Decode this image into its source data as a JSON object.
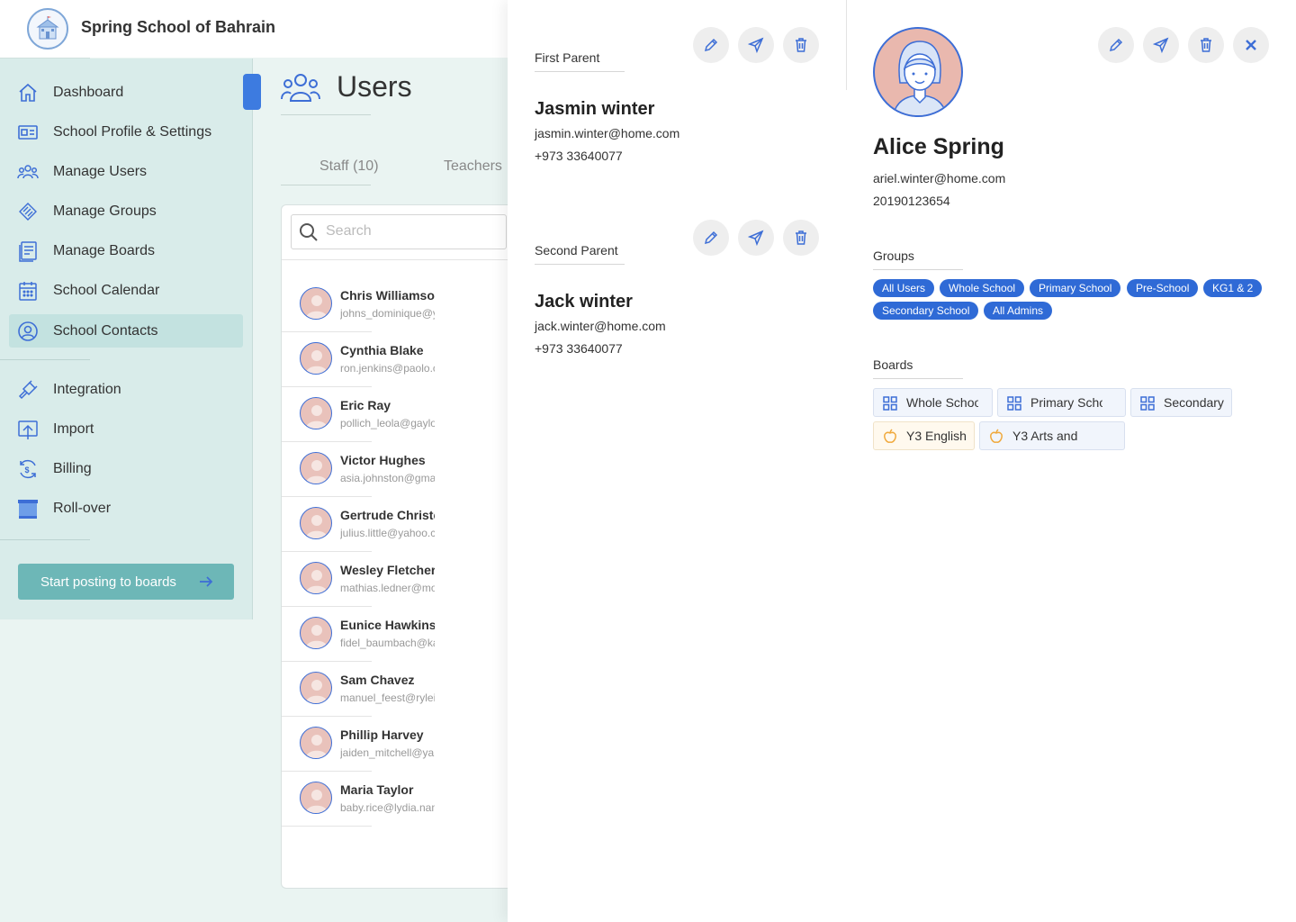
{
  "app": {
    "school_name": "Spring School of Bahrain"
  },
  "sidebar": {
    "items": [
      {
        "label": "Dashboard",
        "icon": "home-icon"
      },
      {
        "label": "School Profile & Settings",
        "icon": "id-card-icon"
      },
      {
        "label": "Manage Users",
        "icon": "users-icon"
      },
      {
        "label": "Manage Groups",
        "icon": "groups-icon"
      },
      {
        "label": "Manage Boards",
        "icon": "board-icon"
      },
      {
        "label": "School Calendar",
        "icon": "calendar-icon"
      },
      {
        "label": "School Contacts",
        "icon": "contact-icon",
        "active": true
      },
      {
        "label": "Integration",
        "icon": "plug-icon"
      },
      {
        "label": "Import",
        "icon": "import-icon"
      },
      {
        "label": "Billing",
        "icon": "billing-icon"
      },
      {
        "label": "Roll-over",
        "icon": "rollover-icon"
      }
    ],
    "cta_label": "Start posting to boards"
  },
  "main": {
    "title": "Users",
    "tabs": [
      {
        "label": "Staff (10)"
      },
      {
        "label": "Teachers"
      }
    ],
    "search": {
      "placeholder": "Search",
      "value": ""
    },
    "users": [
      {
        "name": "Chris Williamson",
        "email": "johns_dominique@yahoo.com"
      },
      {
        "name": "Cynthia Blake",
        "email": "ron.jenkins@paolo.com"
      },
      {
        "name": "Eric Ray",
        "email": "pollich_leola@gaylord.com"
      },
      {
        "name": "Victor Hughes",
        "email": "asia.johnston@gmail.com"
      },
      {
        "name": "Gertrude Christensen",
        "email": "julius.little@yahoo.com"
      },
      {
        "name": "Wesley Fletcher",
        "email": "mathias.ledner@mohr.com"
      },
      {
        "name": "Eunice Hawkins",
        "email": "fidel_baumbach@kanza.com"
      },
      {
        "name": "Sam Chavez",
        "email": "manuel_feest@ryleigh.com"
      },
      {
        "name": "Phillip Harvey",
        "email": "jaiden_mitchell@yahoo.com"
      },
      {
        "name": "Maria Taylor",
        "email": "baby.rice@lydia.name"
      }
    ]
  },
  "detail": {
    "first_parent": {
      "label": "First Parent",
      "name": "Jasmin winter",
      "email": "jasmin.winter@home.com",
      "phone": "+973 33640077"
    },
    "second_parent": {
      "label": "Second Parent",
      "name": "Jack winter",
      "email": "jack.winter@home.com",
      "phone": "+973 33640077"
    },
    "profile": {
      "name": "Alice Spring",
      "email": "ariel.winter@home.com",
      "id": "20190123654"
    },
    "groups_label": "Groups",
    "groups": [
      "All Users",
      "Whole School",
      "Primary School",
      "Pre-School",
      "KG1 & 2",
      "Secondary School",
      "All Admins"
    ],
    "boards_label": "Boards",
    "boards": [
      {
        "label": "Whole School",
        "icon": "grid-icon"
      },
      {
        "label": "Primary School",
        "icon": "grid-icon"
      },
      {
        "label": "Secondary",
        "icon": "grid-icon"
      },
      {
        "label": "Y3 English",
        "icon": "apple-icon"
      },
      {
        "label": "Y3 Arts and",
        "icon": "apple-icon"
      }
    ]
  },
  "colors": {
    "accent": "#3d7be0",
    "chip": "#2f6ad6",
    "sidebar_bg": "#d9ecea",
    "cta": "#6db7b7"
  }
}
